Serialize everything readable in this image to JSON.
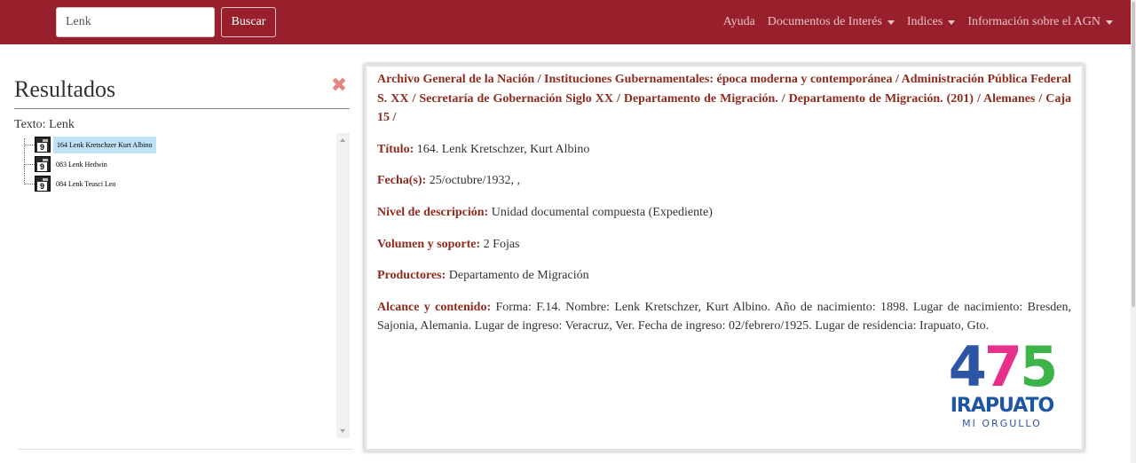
{
  "navbar": {
    "search_value": "Lenk",
    "search_button": "Buscar",
    "links": [
      {
        "label": "Ayuda",
        "dropdown": false
      },
      {
        "label": "Documentos de Interés",
        "dropdown": true
      },
      {
        "label": "Indices",
        "dropdown": true
      },
      {
        "label": "Información sobre el AGN",
        "dropdown": true
      }
    ],
    "color": "#98202c"
  },
  "results": {
    "title": "Resultados",
    "close_icon": "close-icon",
    "search_text": "Texto: Lenk",
    "items": [
      {
        "label": "164 Lenk Kretschzer Kurt Albino",
        "selected": true,
        "icon": "document-icon",
        "icon_text": "9"
      },
      {
        "label": "083 Lenk Hedwin",
        "selected": false,
        "icon": "document-icon",
        "icon_text": "9"
      },
      {
        "label": "084 Lenk Teusci Leo",
        "selected": false,
        "icon": "document-icon",
        "icon_text": "9"
      }
    ]
  },
  "detail": {
    "breadcrumb": "Archivo General de la Nación / Instituciones Gubernamentales: época moderna y contemporánea / Administración Pública Federal S. XX / Secretaría de Gobernación Siglo XX / Departamento de Migración. / Departamento de Migración. (201) / Alemanes / Caja 15 /",
    "fields": [
      {
        "key": "Título:",
        "value": "164. Lenk Kretschzer, Kurt Albino"
      },
      {
        "key": "Fecha(s):",
        "value": "25/octubre/1932, ,"
      },
      {
        "key": "Nivel de descripción:",
        "value": "Unidad documental compuesta (Expediente)"
      },
      {
        "key": "Volumen y soporte:",
        "value": "2 Fojas"
      },
      {
        "key": "Productores:",
        "value": "Departamento de Migración"
      },
      {
        "key": "Alcance y contenido:",
        "value": "Forma: F.14. Nombre: Lenk Kretschzer, Kurt Albino. Año de nacimiento: 1898. Lugar de nacimiento: Bresden, Sajonia, Alemania. Lugar de ingreso: Veracruz, Ver. Fecha de ingreso: 02/febrero/1925. Lugar de residencia: Irapuato, Gto."
      }
    ],
    "accent_color": "#8f2b1e"
  },
  "logo": {
    "digit_1": "4",
    "digit_2": "7",
    "digit_3": "5",
    "city": "IRAPUATO",
    "tagline": "MI ORGULLO"
  }
}
